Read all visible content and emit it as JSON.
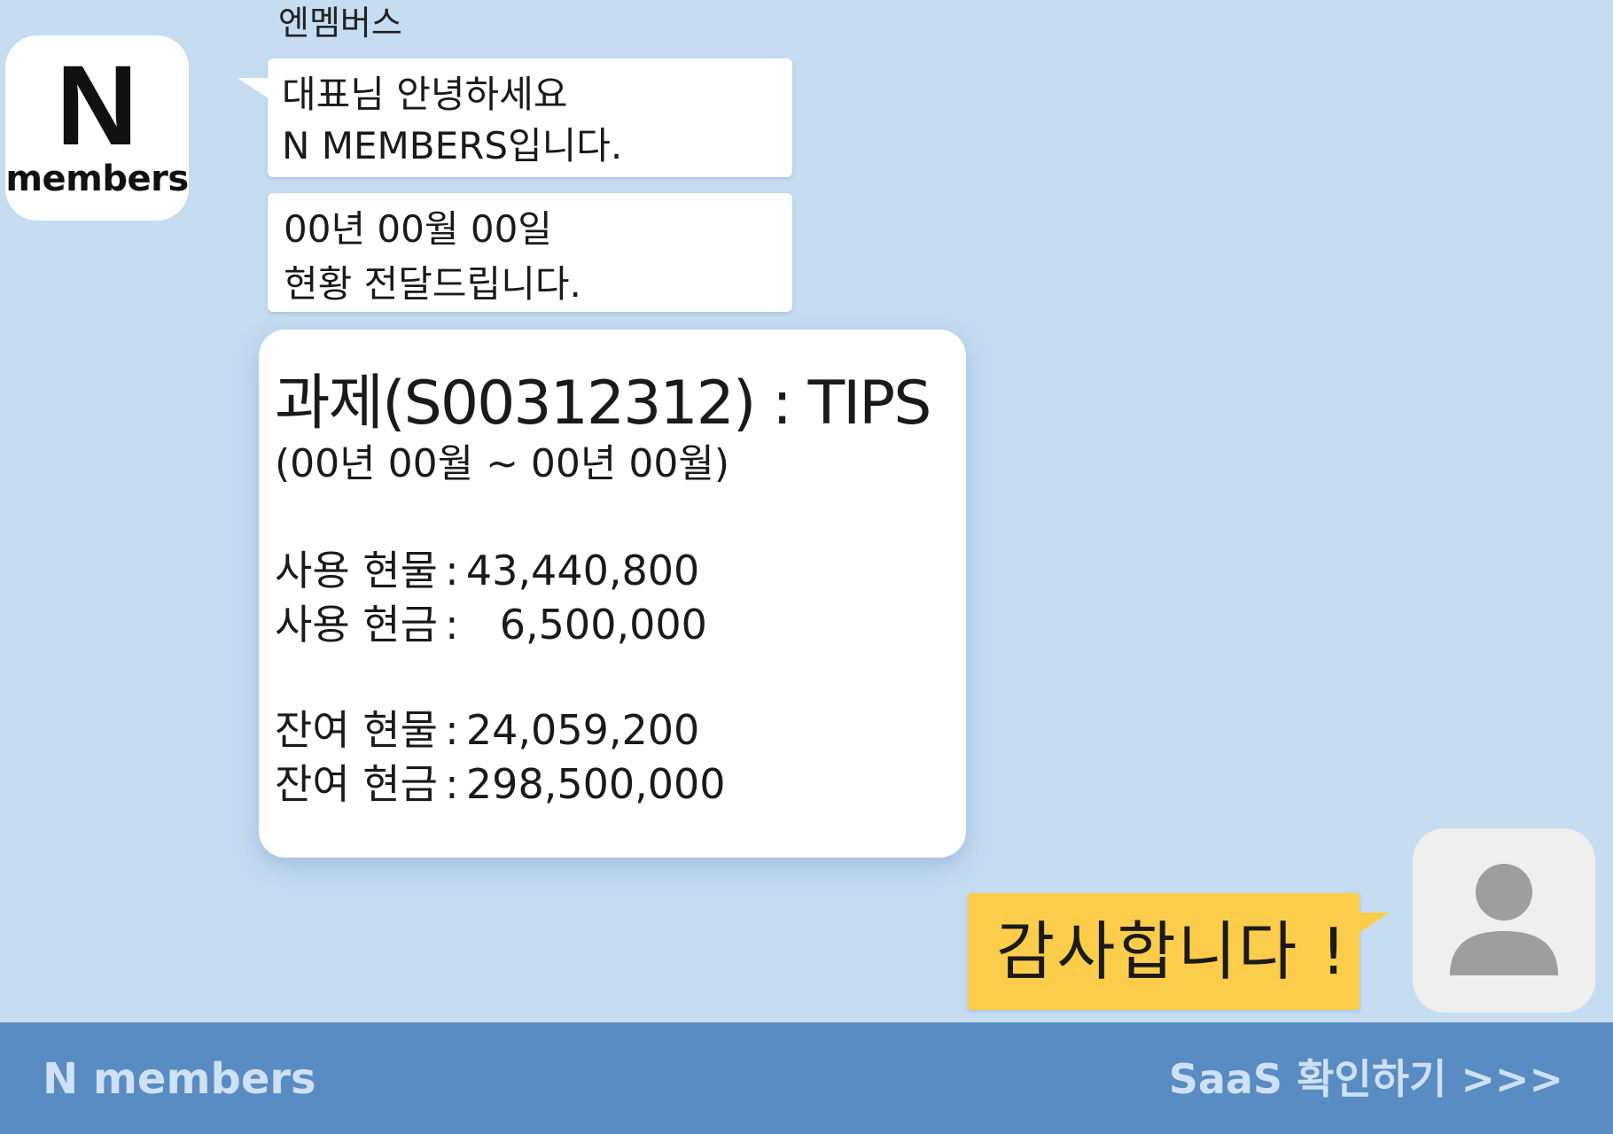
{
  "sender": {
    "name": "엔멤버스",
    "avatar": {
      "logo_letter": "N",
      "logo_text": "members"
    }
  },
  "messages": {
    "greeting": {
      "line1": "대표님 안녕하세요",
      "line2": "N MEMBERS입니다."
    },
    "status": {
      "line1": "00년 00월 00일",
      "line2": "현황 전달드립니다."
    },
    "report": {
      "title": "과제(S00312312) : TIPS",
      "period": "(00년 00월 ~ 00년 00월)",
      "used": [
        {
          "label": "사용 현물",
          "colon": ":",
          "value": "43,440,800"
        },
        {
          "label": "사용 현금",
          "colon": ":",
          "value": "6,500,000"
        }
      ],
      "remaining": [
        {
          "label": "잔여 현물",
          "colon": ":",
          "value": "24,059,200"
        },
        {
          "label": "잔여 현금",
          "colon": ":",
          "value": "298,500,000"
        }
      ]
    },
    "reply": {
      "text": "감사합니다 !"
    }
  },
  "footer": {
    "brand": "N members",
    "cta": "SaaS 확인하기 >>>"
  },
  "colors": {
    "background": "#c5dcf1",
    "bubble": "#ffffff",
    "reply_bubble": "#fccd4a",
    "footer": "#588cc2",
    "footer_text": "#cfe1f4",
    "user_avatar_bg": "#efefef",
    "user_icon": "#9e9e9e"
  },
  "icons": {
    "user_avatar": "user-silhouette-icon"
  }
}
